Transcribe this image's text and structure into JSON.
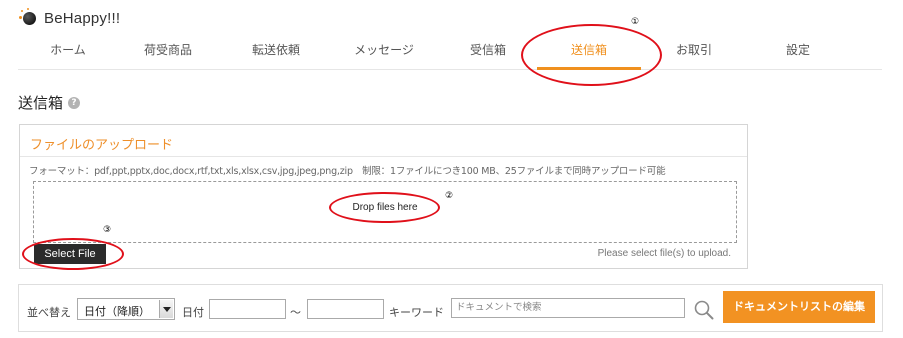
{
  "brand": {
    "name": "BeHappy!!!",
    "logo_icon": "orb-sparkle-icon",
    "accent_color": "#f0901e"
  },
  "nav": {
    "items": [
      {
        "label": "ホーム",
        "active": false
      },
      {
        "label": "荷受商品",
        "active": false
      },
      {
        "label": "転送依頼",
        "active": false
      },
      {
        "label": "メッセージ",
        "active": false
      },
      {
        "label": "受信箱",
        "active": false
      },
      {
        "label": "送信箱",
        "active": true
      },
      {
        "label": "お取引",
        "active": false
      },
      {
        "label": "設定",
        "active": false
      }
    ]
  },
  "annotations": {
    "n1": "①",
    "n2": "②",
    "n3": "③",
    "color": "#e0101a"
  },
  "page": {
    "title": "送信箱",
    "help_icon": "question-circle-icon",
    "help_glyph": "?"
  },
  "upload": {
    "heading": "ファイルのアップロード",
    "format_text": "フォーマット：pdf,ppt,pptx,doc,docx,rtf,txt,xls,xlsx,csv,jpg,jpeg,png,zip　制限：1ファイルにつき100 MB、25ファイルまで同時アップロード可能",
    "dropzone_text": "Drop files here",
    "select_button": "Select File",
    "hint": "Please select file(s) to upload."
  },
  "filters": {
    "sort_label": "並べ替え",
    "sort_value": "日付（降順）",
    "date_label": "日付",
    "date_from": "",
    "range_sep": "～",
    "date_to": "",
    "keyword_label": "キーワード",
    "keyword_placeholder": "ドキュメントで検索",
    "search_icon": "magnifier-icon",
    "edit_button": "ドキュメントリストの編集"
  }
}
